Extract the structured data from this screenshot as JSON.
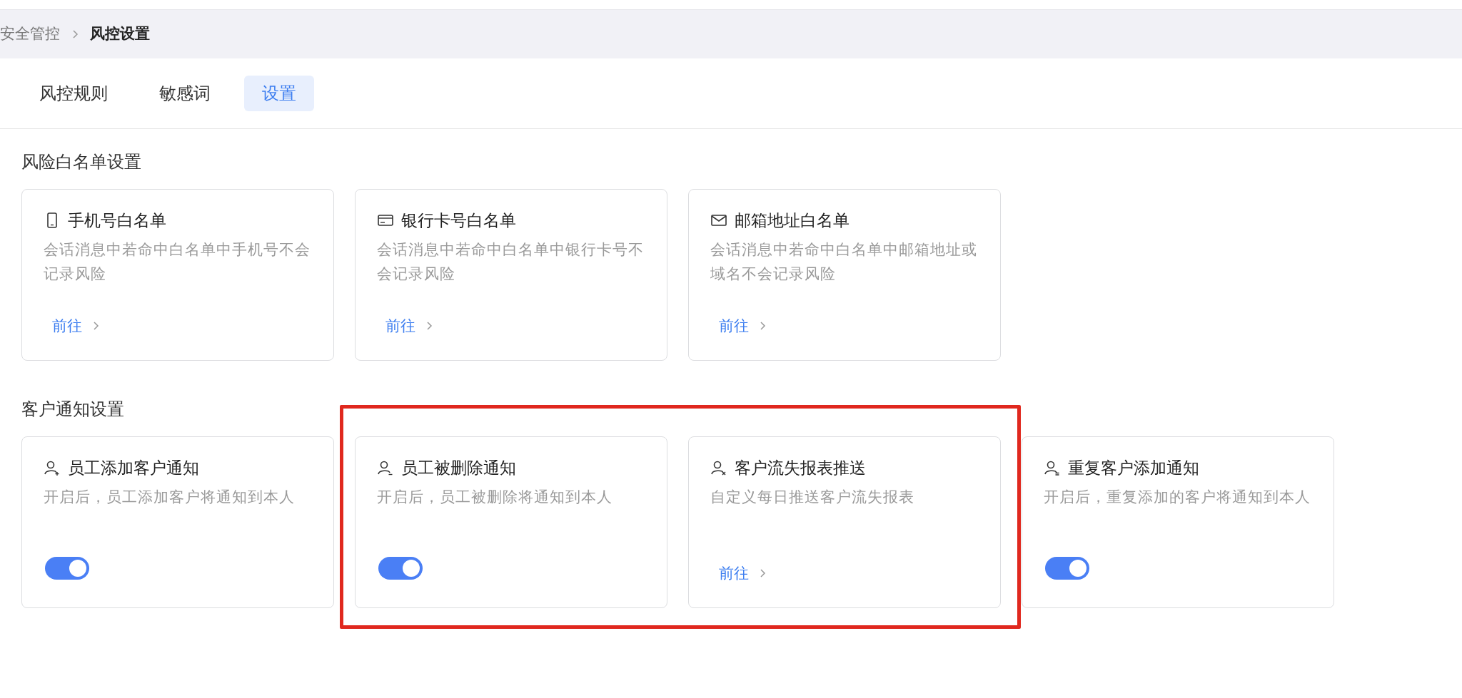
{
  "breadcrumb": [
    {
      "label": "安全管控",
      "current": false
    },
    {
      "label": "风控设置",
      "current": true
    }
  ],
  "tabs": [
    {
      "label": "风控规则",
      "selected": false
    },
    {
      "label": "敏感词",
      "selected": false
    },
    {
      "label": "设置",
      "selected": true
    }
  ],
  "sections": [
    {
      "title": "风险白名单设置",
      "cards": [
        {
          "kind": "link",
          "title": "手机号白名单",
          "description": "会话消息中若命中白名单中手机号不会记录风险",
          "link": "前往"
        },
        {
          "kind": "link",
          "title": "银行卡号白名单",
          "description": "会话消息中若命中白名单中银行卡号不会记录风险",
          "link": "前往"
        },
        {
          "kind": "link",
          "title": "邮箱地址白名单",
          "description": "会话消息中若命中白名单中邮箱地址或域名不会记录风险",
          "link": "前往"
        }
      ]
    },
    {
      "title": "客户通知设置",
      "cards": [
        {
          "kind": "toggle",
          "title": "员工添加客户通知",
          "description": "开启后，员工添加客户将通知到本人",
          "on": true
        },
        {
          "kind": "highlight_group",
          "cards": [
            {
              "kind": "toggle",
              "title": "员工被删除通知",
              "description": "开启后，员工被删除将通知到本人",
              "on": true
            },
            {
              "kind": "link",
              "title": "客户流失报表推送",
              "description": "自定义每日推送客户流失报表",
              "link": "前往"
            }
          ]
        },
        {
          "kind": "toggle",
          "title": "重复客户添加通知",
          "description": "开启后，重复添加的客户将通知到本人",
          "on": true
        }
      ]
    }
  ]
}
